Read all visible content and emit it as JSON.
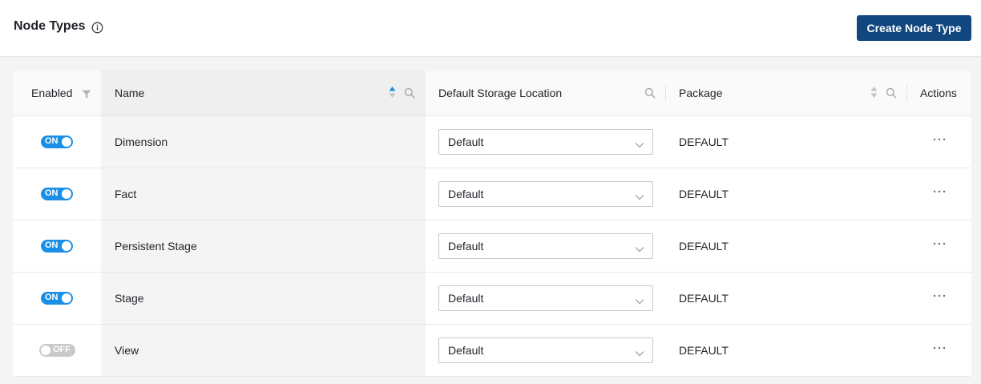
{
  "header": {
    "title": "Node Types",
    "info_icon": "info-icon",
    "create_button": "Create Node Type"
  },
  "table": {
    "columns": {
      "enabled": "Enabled",
      "name": "Name",
      "storage": "Default Storage Location",
      "package": "Package",
      "actions": "Actions"
    },
    "rows": [
      {
        "enabled": true,
        "toggle_text": "ON",
        "name": "Dimension",
        "storage": "Default",
        "package": "DEFAULT"
      },
      {
        "enabled": true,
        "toggle_text": "ON",
        "name": "Fact",
        "storage": "Default",
        "package": "DEFAULT"
      },
      {
        "enabled": true,
        "toggle_text": "ON",
        "name": "Persistent Stage",
        "storage": "Default",
        "package": "DEFAULT"
      },
      {
        "enabled": true,
        "toggle_text": "ON",
        "name": "Stage",
        "storage": "Default",
        "package": "DEFAULT"
      },
      {
        "enabled": false,
        "toggle_text": "OFF",
        "name": "View",
        "storage": "Default",
        "package": "DEFAULT"
      }
    ]
  },
  "colors": {
    "primary_button": "#12467f",
    "toggle_on": "#1a8fe8",
    "toggle_off": "#c9c9c9",
    "sort_active": "#1a8fe8"
  }
}
